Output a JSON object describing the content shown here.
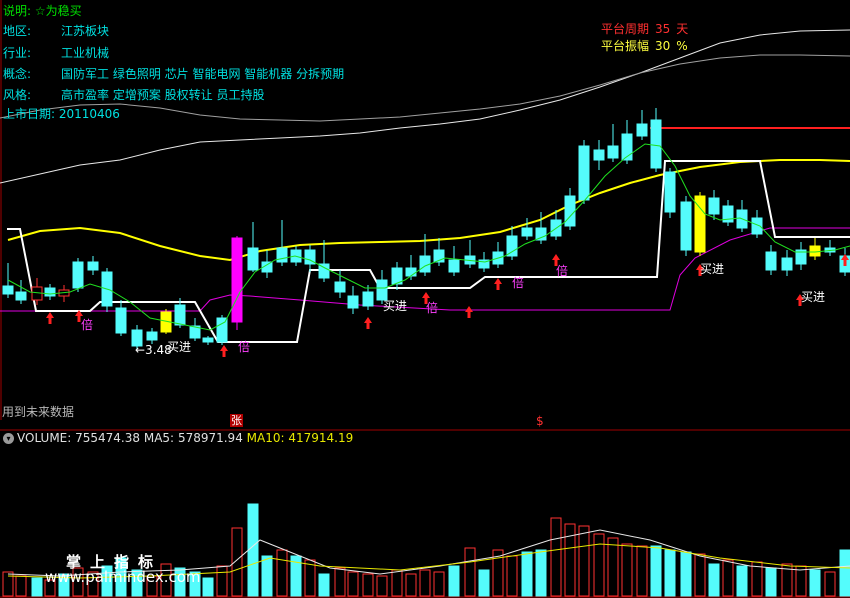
{
  "info": {
    "title": "说明: ☆为稳买",
    "region_key": "地区:",
    "region_val": "江苏板块",
    "industry_key": "行业:",
    "industry_val": "工业机械",
    "concept_key": "概念:",
    "concept_val": "国防军工 绿色照明 芯片 智能电网 智能机器 分拆预期",
    "style_key": "风格:",
    "style_val": "高市盈率 定增预案 股权转让 员工持股",
    "listing": "上市日期: 20110406"
  },
  "platform": {
    "period_label": "平台周期",
    "period_value": "35",
    "period_unit": "天",
    "amplitude_label": "平台振幅",
    "amplitude_value": "30",
    "amplitude_unit": "%"
  },
  "annotations": {
    "low_price": "←3.48",
    "buy1": "买进",
    "buy2": "买进",
    "buy3": "买进",
    "buy4": "买进",
    "bei1": "倍",
    "bei2": "倍",
    "bei3": "倍",
    "bei4": "倍",
    "bei5": "倍",
    "future": "用到未来数据",
    "zhang": "张",
    "dollar": "$"
  },
  "volume": {
    "label": "VOLUME:",
    "value": "755474.38",
    "ma5_label": "MA5:",
    "ma5_value": "578971.94",
    "ma10_label": "MA10:",
    "ma10_value": "417914.19"
  },
  "watermark": {
    "cn": "掌上指标",
    "url": "www.palmindex.com"
  },
  "colors": {
    "up": "#ff3232",
    "down": "#54fcfc",
    "magenta": "#ff00ff",
    "yellow": "#ffff00",
    "info_text": "#00e0e0"
  }
}
